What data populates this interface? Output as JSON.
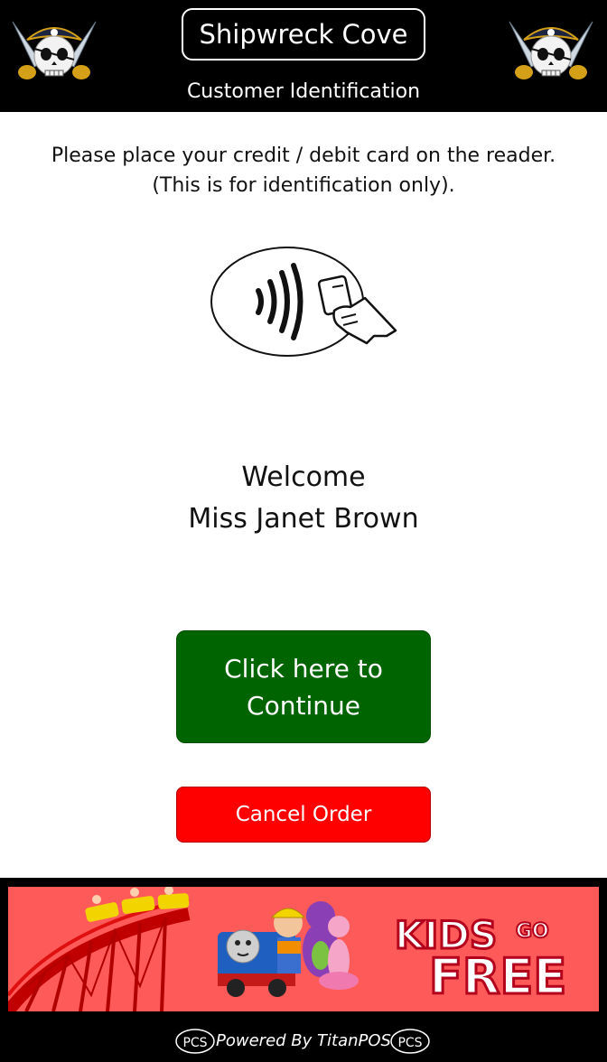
{
  "header": {
    "app_title": "Shipwreck Cove",
    "subtitle": "Customer Identification",
    "logo_icon": "pirate-skull-crossed-swords-icon"
  },
  "main": {
    "instruction_line1": "Please place your credit / debit card on the reader.",
    "instruction_line2": "(This is for identification only).",
    "reader_icon": "contactless-card-reader-icon",
    "welcome_line1": "Welcome",
    "welcome_line2": "Miss Janet Brown",
    "continue_line1": "Click here to",
    "continue_line2": "Continue",
    "cancel_label": "Cancel Order"
  },
  "banner": {
    "text_top": "KIDS",
    "text_go": "GO",
    "text_bottom": "FREE"
  },
  "footer": {
    "powered_by": "Powered By TitanPOS",
    "logo_text": "PCS"
  },
  "colors": {
    "header_bg": "#000000",
    "continue_bg": "#006400",
    "cancel_bg": "#ff0000",
    "banner_bg": "#ff5a5a"
  }
}
